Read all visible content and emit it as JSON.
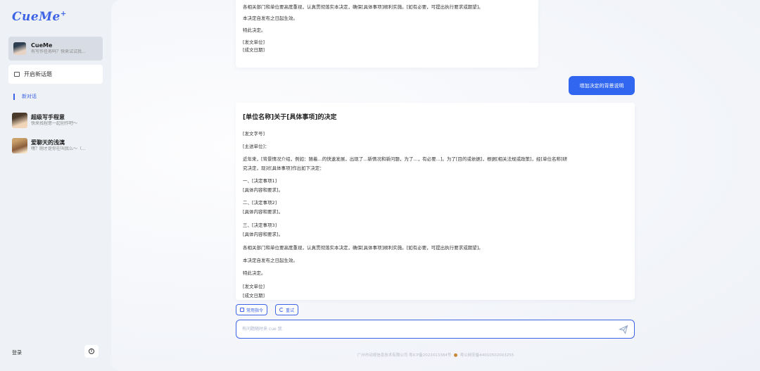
{
  "sidebar": {
    "logo": "CueMe",
    "logo_sup": "+",
    "active_chat": {
      "name": "CueMe",
      "subtitle": "有写作任务吗？快来试试我..."
    },
    "new_topic_label": "开启新话题",
    "new_conversation_label": "新对话",
    "history": [
      {
        "name": "超级写手程意",
        "subtitle": "快来找程意一起创作吧～"
      },
      {
        "name": "爱聊天的浅漓",
        "subtitle": "嘿？刚才是你在叫我么～（..."
      }
    ],
    "login_label": "登录",
    "info_icon": "info-icon"
  },
  "conversation": {
    "previous_reply_tail": [
      "各相关部门和单位要高度重视，认真贯彻落实本决定，确保[具体事项]顺利实施。[如有必要，可提出执行要求或期望]。",
      "本决定自发布之日起生效。",
      "特此决定。",
      "[发文单位]",
      "[成文日期]"
    ],
    "user_message": "增加决定的背景说明",
    "reply": {
      "title": "[单位名称]关于[具体事项]的决定",
      "lines": [
        "[发文字号]",
        "[主送单位]：",
        "近年来，[背景情况介绍，例如：随着...的快速发展，出现了...新情况和新问题，为了...，有必要...]。为了[目的或依据]，根据[相关法规或政策]，经[单位名称]研",
        "究决定，现对[具体事项]作出如下决定：",
        "一、[决定事项1]",
        "[具体内容和要求]。",
        "二、[决定事项2]",
        "[具体内容和要求]。",
        "三、[决定事项3]",
        "[具体内容和要求]。",
        "各相关部门和单位要高度重视，认真贯彻落实本决定，确保[具体事项]顺利实施。[如有必要，可提出执行要求或期望]。",
        "本决定自发布之日起生效。",
        "特此决定。",
        "[发文单位]",
        "[成文日期]"
      ]
    }
  },
  "actions": {
    "common_commands": "常用指令",
    "retry": "重试"
  },
  "input": {
    "placeholder": "有问题随时来 cue 我",
    "value": ""
  },
  "footer": {
    "icp": "广州市动视信息技术有限公司 粤ICP备2022013384号",
    "police": "粤公网安备44010502003255"
  },
  "colors": {
    "accent": "#3d63e6",
    "user_bubble": "#3166f0"
  }
}
